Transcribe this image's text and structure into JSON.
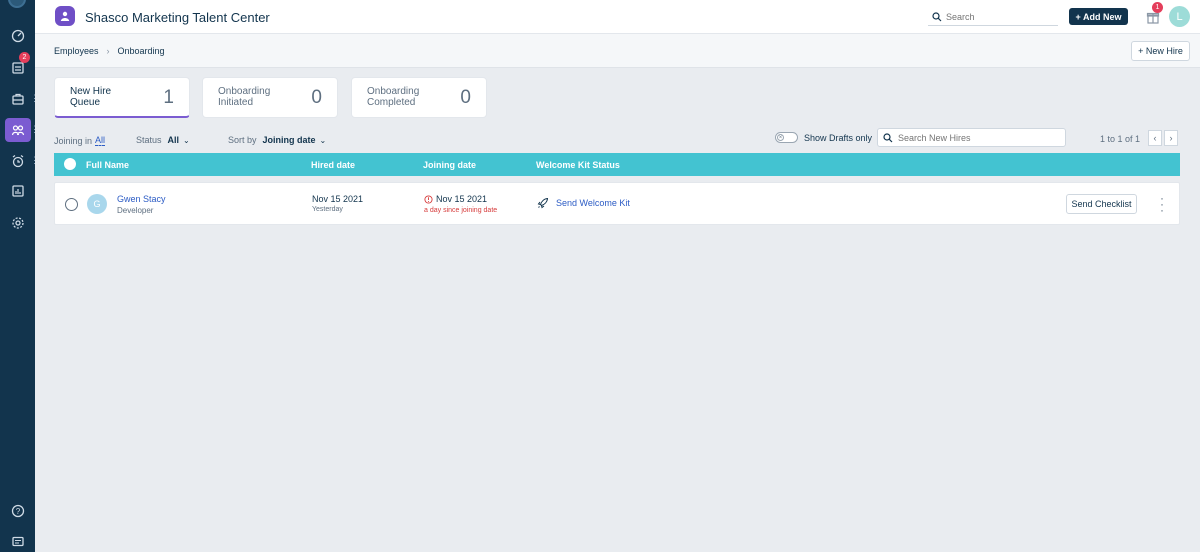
{
  "app": {
    "title": "Shasco Marketing Talent Center",
    "search_placeholder": "Search",
    "add_new_label": "+ Add New",
    "gift_badge_count": "1",
    "user_initial": "L"
  },
  "sidebar": {
    "badge_count": "2",
    "items": [
      {
        "icon": "speedometer-icon"
      },
      {
        "icon": "tasks-icon"
      },
      {
        "icon": "briefcase-icon"
      },
      {
        "icon": "onboarding-icon",
        "active": true
      },
      {
        "icon": "alarm-icon"
      },
      {
        "icon": "reports-icon"
      },
      {
        "icon": "settings-icon"
      },
      {
        "icon": "help-icon"
      },
      {
        "icon": "chat-icon"
      }
    ]
  },
  "breadcrumb": {
    "root": "Employees",
    "current": "Onboarding",
    "new_hire_button": "+ New Hire"
  },
  "summary_cards": [
    {
      "label": "New Hire Queue",
      "count": "1",
      "active": true
    },
    {
      "label": "Onboarding Initiated",
      "count": "0",
      "active": false
    },
    {
      "label": "Onboarding Completed",
      "count": "0",
      "active": false
    }
  ],
  "filters": {
    "joining_label": "Joining in",
    "joining_value": "All",
    "status_label": "Status",
    "status_value": "All",
    "sort_label": "Sort by",
    "sort_value": "Joining date",
    "drafts_label": "Show Drafts only",
    "search_placeholder": "Search New Hires",
    "pager_text": "1 to 1 of 1"
  },
  "table": {
    "columns": [
      "Full Name",
      "Hired date",
      "Joining date",
      "Welcome Kit Status"
    ],
    "rows": [
      {
        "avatar_initial": "G",
        "name": "Gwen Stacy",
        "role": "Developer",
        "hired_date": "Nov 15 2021",
        "hired_relative": "Yesterday",
        "joining_date": "Nov 15 2021",
        "joining_note": "a day since joining date",
        "welcome_kit_action": "Send Welcome Kit",
        "checklist_button": "Send Checklist"
      }
    ]
  },
  "colors": {
    "rail": "#12344d",
    "accent": "#7b5cd1",
    "table_header": "#43c3d1",
    "link": "#2c5cc5",
    "danger": "#d63b3b"
  }
}
